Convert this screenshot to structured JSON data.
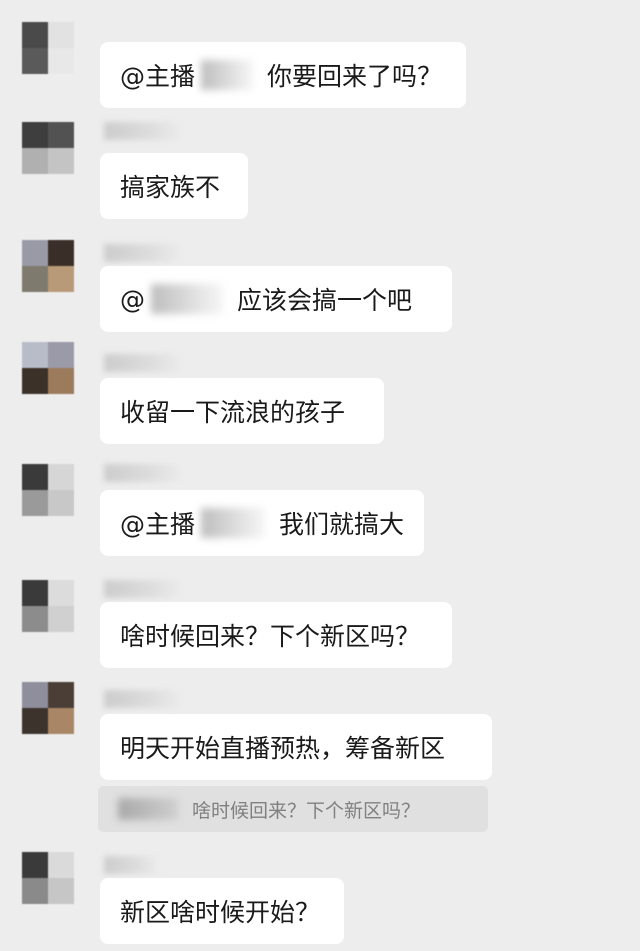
{
  "messages": [
    {
      "mention": "@主播",
      "text": "你要回来了吗？"
    },
    {
      "mention": "",
      "text": "搞家族不"
    },
    {
      "mention": "@",
      "text": "应该会搞一个吧"
    },
    {
      "mention": "",
      "text": "收留一下流浪的孩子"
    },
    {
      "mention": "@主播",
      "text": "我们就搞大"
    },
    {
      "mention": "",
      "text": "啥时候回来？下个新区吗？"
    },
    {
      "mention": "",
      "text": "明天开始直播预热，筹备新区"
    },
    {
      "mention": "",
      "text": "新区啥时候开始？"
    }
  ],
  "quote": {
    "text": "啥时候回来？下个新区吗？"
  },
  "colors": {
    "background": "#ededed",
    "bubble": "#ffffff",
    "quote_background": "#e0e0e0",
    "quote_text": "#808080"
  },
  "icons": [
    "avatar-image"
  ]
}
